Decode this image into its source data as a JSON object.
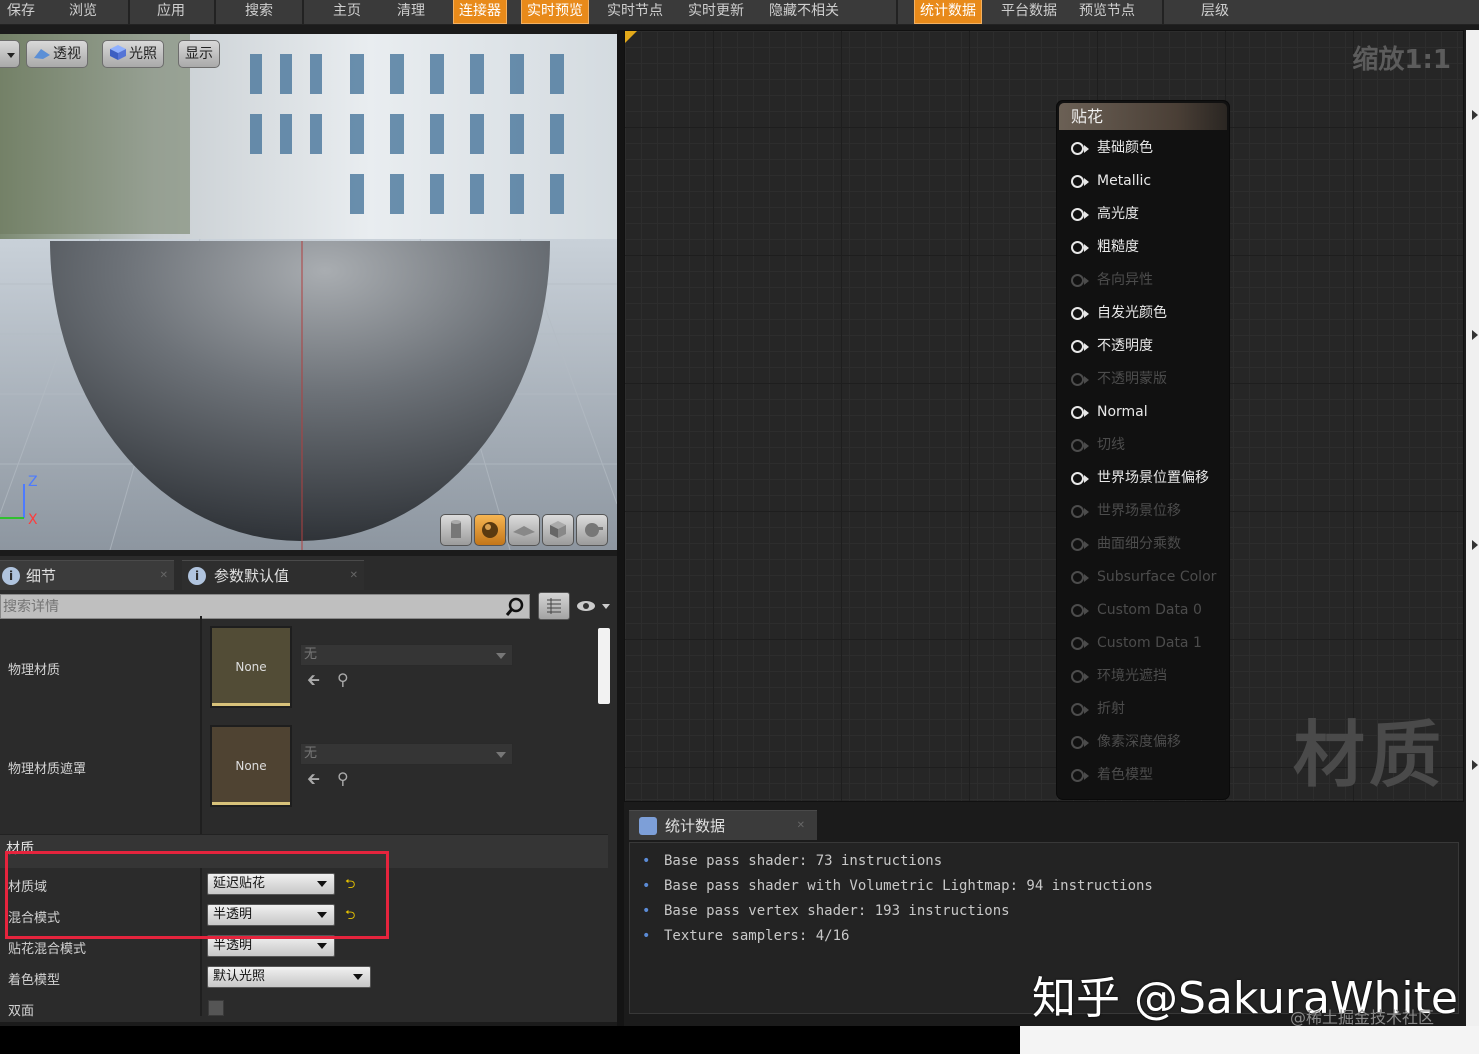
{
  "toolbar": {
    "items": [
      "保存",
      "浏览",
      "应用",
      "搜索",
      "主页",
      "清理",
      "连接器",
      "实时预览",
      "实时节点",
      "实时更新",
      "隐藏不相关",
      "统计数据",
      "平台数据",
      "预览节点",
      "层级"
    ]
  },
  "viewport": {
    "buttons": {
      "perspective": "透视",
      "lighting": "光照",
      "show": "显示"
    },
    "axes": {
      "z": "Z",
      "x": "X"
    }
  },
  "details": {
    "tabs": {
      "details": "细节",
      "param_defaults": "参数默认值"
    },
    "search": {
      "placeholder": "搜索详情"
    },
    "rows": {
      "phys_mat": {
        "label": "物理材质",
        "thumb": "None",
        "value": "无"
      },
      "phys_mask": {
        "label": "物理材质遮罩",
        "thumb": "None",
        "value": "无"
      }
    },
    "section_material": "材质",
    "props": [
      {
        "label": "材质域",
        "value": "延迟贴花"
      },
      {
        "label": "混合模式",
        "value": "半透明"
      },
      {
        "label": "贴花混合模式",
        "value": "半透明"
      },
      {
        "label": "着色模型",
        "value": "默认光照"
      },
      {
        "label": "双面",
        "value": ""
      }
    ]
  },
  "graph": {
    "zoom": "缩放1:1",
    "watermark": "材质",
    "node": {
      "title": "贴花",
      "pins": [
        {
          "label": "基础颜色",
          "enabled": true
        },
        {
          "label": "Metallic",
          "enabled": true
        },
        {
          "label": "高光度",
          "enabled": true
        },
        {
          "label": "粗糙度",
          "enabled": true
        },
        {
          "label": "各向异性",
          "enabled": false
        },
        {
          "label": "自发光颜色",
          "enabled": true
        },
        {
          "label": "不透明度",
          "enabled": true
        },
        {
          "label": "不透明蒙版",
          "enabled": false
        },
        {
          "label": "Normal",
          "enabled": true
        },
        {
          "label": "切线",
          "enabled": false
        },
        {
          "label": "世界场景位置偏移",
          "enabled": true
        },
        {
          "label": "世界场景位移",
          "enabled": false
        },
        {
          "label": "曲面细分乘数",
          "enabled": false
        },
        {
          "label": "Subsurface Color",
          "enabled": false
        },
        {
          "label": "Custom Data 0",
          "enabled": false
        },
        {
          "label": "Custom Data 1",
          "enabled": false
        },
        {
          "label": "环境光遮挡",
          "enabled": false
        },
        {
          "label": "折射",
          "enabled": false
        },
        {
          "label": "像素深度偏移",
          "enabled": false
        },
        {
          "label": "着色模型",
          "enabled": false
        }
      ]
    }
  },
  "stats": {
    "tab": "统计数据",
    "lines": [
      "Base pass shader: 73 instructions",
      "Base pass shader with Volumetric Lightmap: 94 instructions",
      "Base pass vertex shader: 193 instructions",
      "Texture samplers: 4/16"
    ]
  },
  "watermarks": {
    "zhihu": "知乎 @SakuraWhite",
    "juejin": "@稀土掘金技术社区"
  },
  "colors": {
    "accent": "#e88a1a",
    "highlight": "#e5243d",
    "pin_enabled": "#e8e8e8",
    "pin_disabled": "#4c4c4c"
  }
}
